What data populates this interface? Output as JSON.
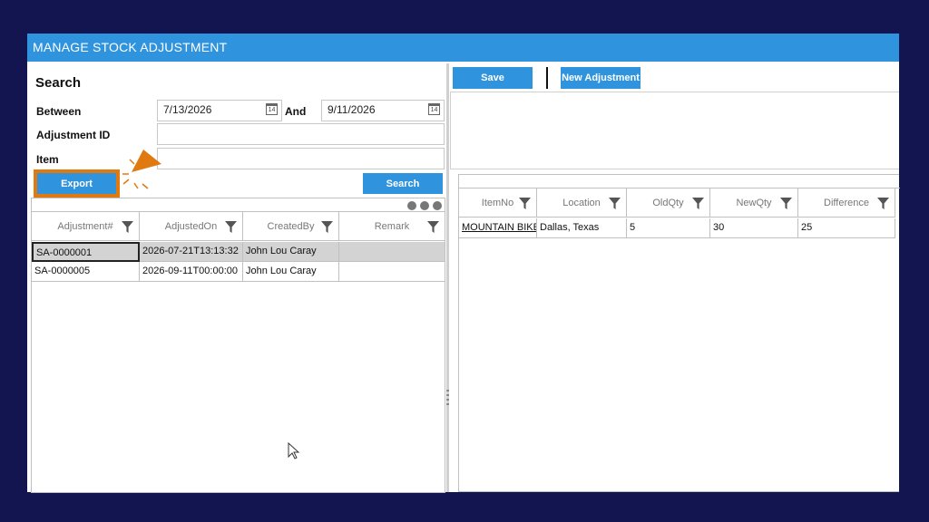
{
  "window": {
    "title": "MANAGE STOCK ADJUSTMENT"
  },
  "search": {
    "heading": "Search",
    "between_label": "Between",
    "date_from": "7/13/2026",
    "and_label": "And",
    "date_to": "9/11/2026",
    "calendar_day": "14",
    "adjustment_id_label": "Adjustment ID",
    "adjustment_id_value": "",
    "item_label": "Item",
    "item_value": "",
    "export_label": "Export",
    "search_label": "Search"
  },
  "list_grid": {
    "columns": [
      "Adjustment#",
      "AdjustedOn",
      "CreatedBy",
      "Remark"
    ],
    "rows": [
      {
        "id": "SA-0000001",
        "adjusted_on": "2026-07-21T13:13:32",
        "created_by": "John Lou Caray",
        "remark": ""
      },
      {
        "id": "SA-0000005",
        "adjusted_on": "2026-09-11T00:00:00",
        "created_by": "John Lou Caray",
        "remark": ""
      }
    ]
  },
  "toolbar": {
    "save_label": "Save",
    "new_adjustment_label": "New Adjustment"
  },
  "detail_grid": {
    "columns": [
      "ItemNo",
      "Location",
      "OldQty",
      "NewQty",
      "Difference"
    ],
    "rows": [
      {
        "item_no": "MOUNTAIN BIKE",
        "location": "Dallas, Texas",
        "old_qty": "5",
        "new_qty": "30",
        "difference": "25"
      }
    ]
  },
  "colors": {
    "accent": "#2f93dd",
    "highlight": "#e07a10",
    "background": "#12154f",
    "selected_row": "#d3d3d3"
  },
  "icons": [
    "calendar-icon",
    "filter-funnel-icon",
    "more-dots-icon",
    "mouse-cursor-icon",
    "pointer-arrow-annotation"
  ]
}
